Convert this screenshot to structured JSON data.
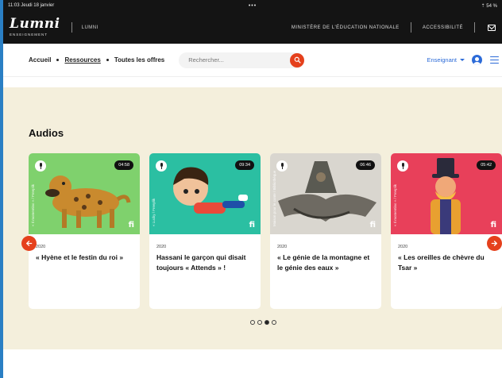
{
  "status_bar": {
    "time": "11:03  Jeudi 18 janvier",
    "dots": "•••",
    "battery": "⇡ 54 %"
  },
  "topbar": {
    "logo": "Lumni",
    "logo_sub": "ENSEIGNEMENT",
    "lumni_link": "LUMNI",
    "ministry_link": "MINISTÈRE DE L'ÉDUCATION NATIONALE",
    "accessibility_link": "ACCESSIBILITÉ"
  },
  "nav": {
    "home": "Accueil",
    "resources": "Ressources",
    "all_offers": "Toutes les offres",
    "search_placeholder": "Rechercher...",
    "role": "Enseignant"
  },
  "section": {
    "title": "Audios",
    "cards": [
      {
        "duration": "04:58",
        "year": "2020",
        "title": "« Hyène et le festin du roi »",
        "thumb_bg": "#7fd16d",
        "vertical_label": "« Il momentino » / Freeplik"
      },
      {
        "duration": "09:34",
        "year": "2020",
        "title": "Hassani le garçon qui disait toujours « Attends » !",
        "thumb_bg": "#2bbfa2",
        "vertical_label": "« Lucky / Freeplik"
      },
      {
        "duration": "06:46",
        "year": "2020",
        "title": "« Le génie de la montagne et le génie des eaux »",
        "thumb_bg": "#d9d6cf",
        "vertical_label": "Maison pour le conte / Bibliothèque"
      },
      {
        "duration": "05:42",
        "year": "2020",
        "title": "« Les oreilles de chèvre du Tsar »",
        "thumb_bg": "#e8405a",
        "vertical_label": "« Il momentino » / Freeplik"
      }
    ],
    "carousel_dots": 4,
    "active_dot": 2
  },
  "colors": {
    "accent": "#e5401c",
    "blue": "#2c6bd8",
    "section_bg": "#f4efdc",
    "topbar": "#141414"
  }
}
